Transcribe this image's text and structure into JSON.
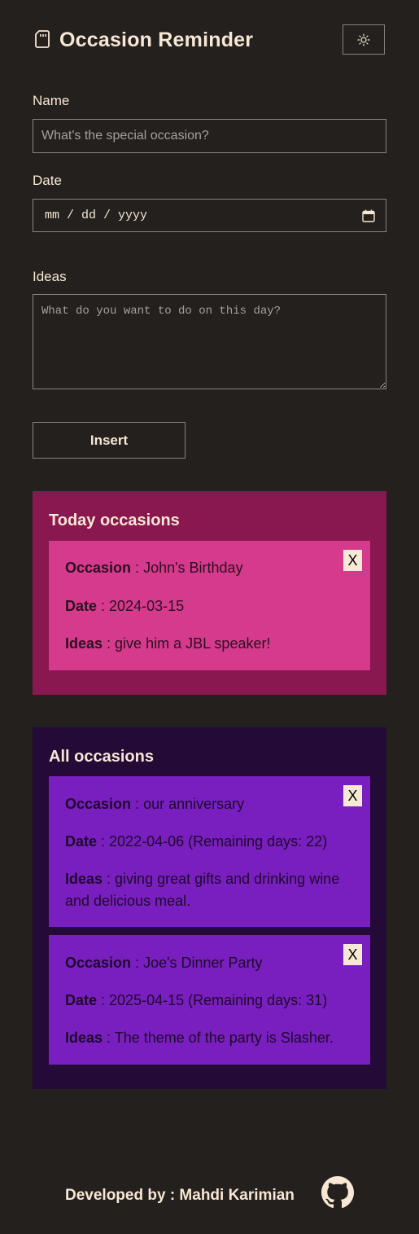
{
  "header": {
    "title": "Occasion Reminder",
    "logo_icon": "sd-card-icon",
    "theme_toggle_icon": "sun-icon"
  },
  "form": {
    "name_label": "Name",
    "name_placeholder": "What's the special occasion?",
    "date_label": "Date",
    "date_placeholder": "mm / dd / yyyy",
    "ideas_label": "Ideas",
    "ideas_placeholder": "What do you want to do on this day?",
    "insert_label": "Insert"
  },
  "today": {
    "title": "Today occasions",
    "items": [
      {
        "occasion_label": "Occasion",
        "occasion": "John's Birthday",
        "date_label": "Date",
        "date": "2024-03-15",
        "ideas_label": "Ideas",
        "ideas": "give him a JBL speaker!",
        "close_label": "X"
      }
    ]
  },
  "all": {
    "title": "All occasions",
    "items": [
      {
        "occasion_label": "Occasion",
        "occasion": "our anniversary",
        "date_label": "Date",
        "date": "2022-04-06 (Remaining days: 22)",
        "ideas_label": "Ideas",
        "ideas": "giving great gifts and drinking wine and delicious meal.",
        "close_label": "X"
      },
      {
        "occasion_label": "Occasion",
        "occasion": "Joe's Dinner Party",
        "date_label": "Date",
        "date": "2025-04-15 (Remaining days: 31)",
        "ideas_label": "Ideas",
        "ideas": "The theme of the party is Slasher.",
        "close_label": "X"
      }
    ]
  },
  "footer": {
    "text": "Developed by : Mahdi Karimian",
    "github_icon": "github-icon"
  },
  "colors": {
    "background": "#23201e",
    "text": "#f7e7d4",
    "today_section": "#8a1850",
    "today_card": "#d63a8c",
    "all_section": "#240a36",
    "all_card": "#7a1fbf",
    "close_button": "#f6ead6"
  }
}
